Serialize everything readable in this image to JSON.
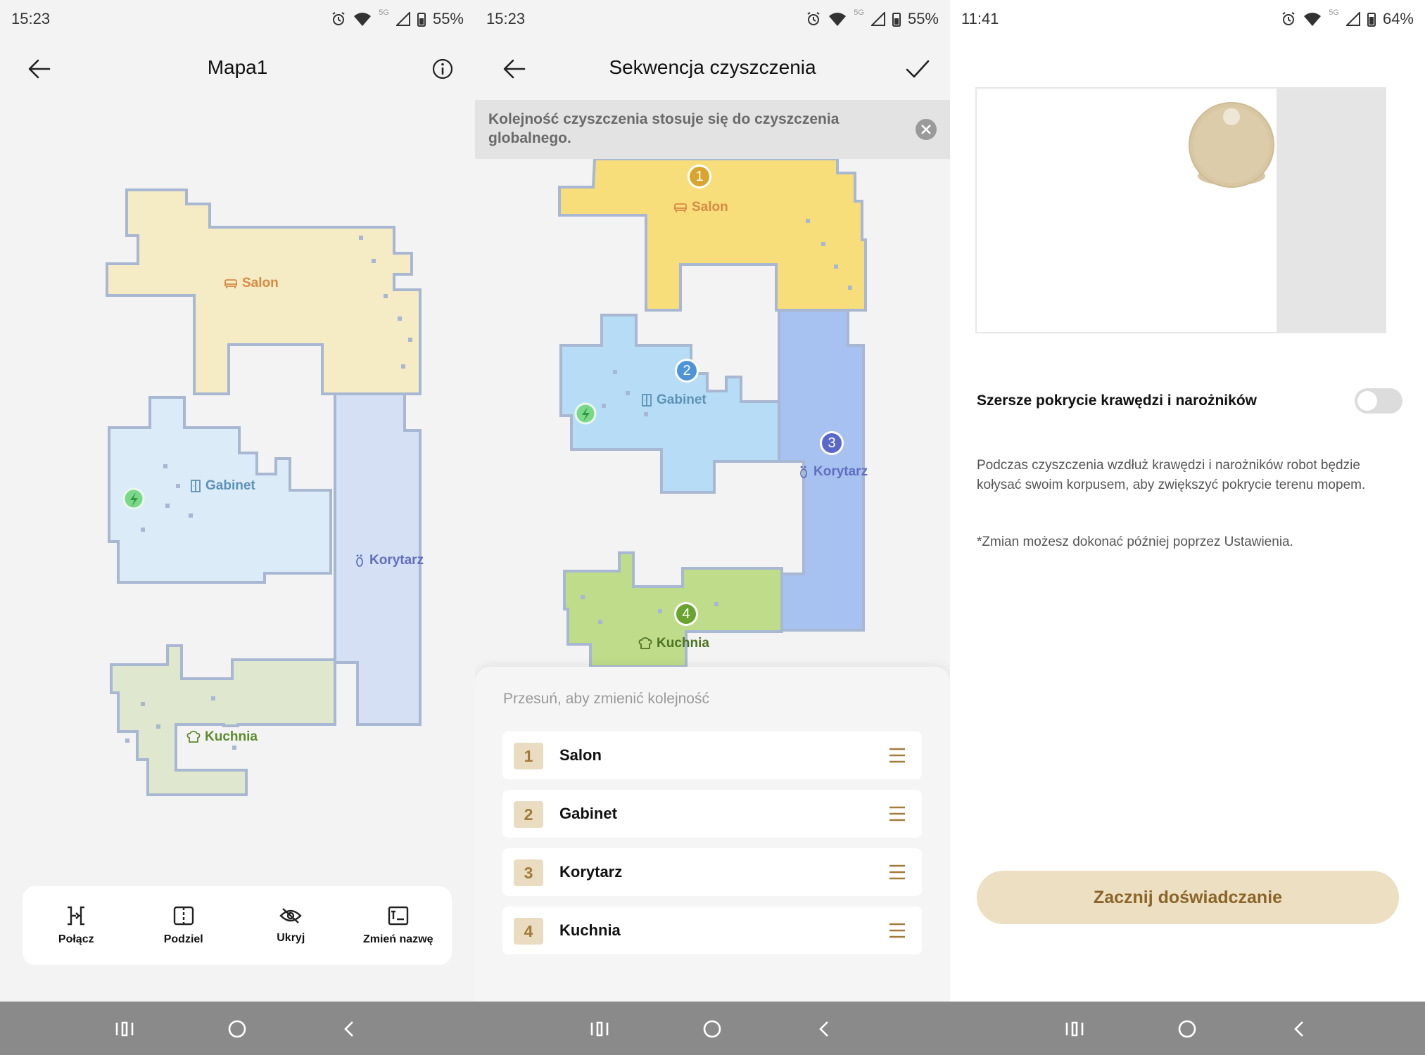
{
  "colors": {
    "salon_map": "#f5ebc5",
    "gabinet_map": "#dcebf8",
    "korytarz_map": "#d5e0f5",
    "kuchnia_map": "#dfe8cf",
    "salon_seq": "#f8de7a",
    "gabinet_seq": "#b7dcf6",
    "korytarz_seq": "#a7c1f0",
    "kuchnia_seq": "#bedc8a",
    "accent_gold": "#a27b3a",
    "nav_bg": "#8a8a8a"
  },
  "panel1": {
    "status": {
      "time": "15:23",
      "battery": "55%",
      "net": "5G"
    },
    "title": "Mapa1",
    "rooms": {
      "salon": "Salon",
      "gabinet": "Gabinet",
      "korytarz": "Korytarz",
      "kuchnia": "Kuchnia"
    },
    "tools": [
      {
        "label": "Połącz",
        "icon": "merge-icon"
      },
      {
        "label": "Podziel",
        "icon": "split-icon"
      },
      {
        "label": "Ukryj",
        "icon": "hide-icon"
      },
      {
        "label": "Zmień nazwę",
        "icon": "rename-icon"
      }
    ]
  },
  "panel2": {
    "status": {
      "time": "15:23",
      "battery": "55%",
      "net": "5G"
    },
    "title": "Sekwencja czyszczenia",
    "banner": "Kolejność czyszczenia stosuje się do czyszczenia globalnego.",
    "rooms": {
      "salon": "Salon",
      "gabinet": "Gabinet",
      "korytarz": "Korytarz",
      "kuchnia": "Kuchnia"
    },
    "markers": [
      "1",
      "2",
      "3",
      "4"
    ],
    "hint": "Przesuń, aby zmienić kolejność",
    "sequence": [
      {
        "num": "1",
        "name": "Salon"
      },
      {
        "num": "2",
        "name": "Gabinet"
      },
      {
        "num": "3",
        "name": "Korytarz"
      },
      {
        "num": "4",
        "name": "Kuchnia"
      }
    ]
  },
  "panel3": {
    "status": {
      "time": "11:41",
      "battery": "64%",
      "net": "5G"
    },
    "setting_label": "Szersze pokrycie krawędzi i narożników",
    "toggle_on": false,
    "description": "Podczas czyszczenia wzdłuż krawędzi i narożników robot będzie kołysać swoim korpusem, aby zwiększyć pokrycie terenu mopem.",
    "note": "*Zmian możesz dokonać później poprzez Ustawienia.",
    "cta": "Zacznij doświadczanie"
  }
}
